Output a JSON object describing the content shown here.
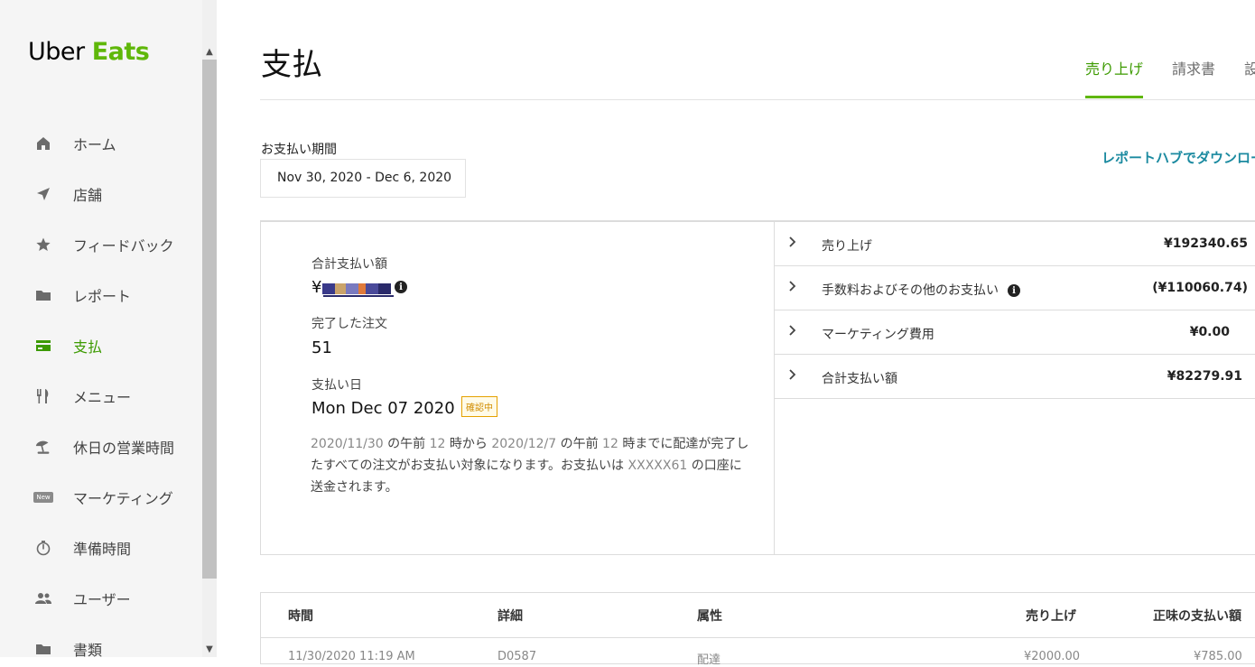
{
  "brand": {
    "uber": "Uber",
    "eats": "Eats",
    "accent": "#5fb709"
  },
  "sidebar": {
    "items": [
      {
        "label": "ホーム",
        "icon": "home-icon"
      },
      {
        "label": "店舗",
        "icon": "location-arrow-icon"
      },
      {
        "label": "フィードバック",
        "icon": "star-icon"
      },
      {
        "label": "レポート",
        "icon": "folder-icon"
      },
      {
        "label": "支払",
        "icon": "credit-card-icon",
        "active": true
      },
      {
        "label": "メニュー",
        "icon": "fork-knife-icon"
      },
      {
        "label": "休日の営業時間",
        "icon": "umbrella-icon"
      },
      {
        "label": "マーケティング",
        "icon": "new-badge-icon",
        "badge": "New"
      },
      {
        "label": "準備時間",
        "icon": "stopwatch-icon"
      },
      {
        "label": "ユーザー",
        "icon": "users-icon"
      },
      {
        "label": "書類",
        "icon": "folder-icon"
      }
    ]
  },
  "header": {
    "title": "支払",
    "tabs": [
      {
        "label": "売り上げ",
        "active": true
      },
      {
        "label": "請求書"
      },
      {
        "label": "設"
      }
    ]
  },
  "period": {
    "label": "お支払い期間",
    "value": "Nov 30, 2020 - Dec 6, 2020"
  },
  "download_link": "レポートハブでダウンロー",
  "summary": {
    "total_label": "合計支払い額",
    "total_currency": "¥",
    "orders_label": "完了した注文",
    "orders_value": "51",
    "payday_label": "支払い日",
    "payday_value": "Mon Dec 07 2020",
    "status_badge": "確認中",
    "desc": {
      "from_date": "2020/11/30",
      "t1": " の午前 ",
      "hour1": "12",
      "t2": " 時から ",
      "to_date": "2020/12/7",
      "t3": " の午前 ",
      "hour2": "12",
      "t4": " 時までに配達が完了したすべての注文がお支払い対象になります。お支払いは ",
      "account": "XXXXX61",
      "t5": " の口座に送金されます。"
    }
  },
  "breakdown": [
    {
      "label": "売り上げ",
      "value": "¥192340.65"
    },
    {
      "label": "手数料およびその他のお支払い",
      "value": "(¥110060.74)",
      "info": true
    },
    {
      "label": "マーケティング費用",
      "value": "¥0.00"
    },
    {
      "label": "合計支払い額",
      "value": "¥82279.91"
    }
  ],
  "table": {
    "headers": [
      "時間",
      "詳細",
      "属性",
      "売り上げ",
      "正味の支払い額"
    ],
    "first_row": [
      "11/30/2020 11:19 AM",
      "D0587",
      "配達",
      "¥2000.00",
      "¥785.00"
    ]
  }
}
